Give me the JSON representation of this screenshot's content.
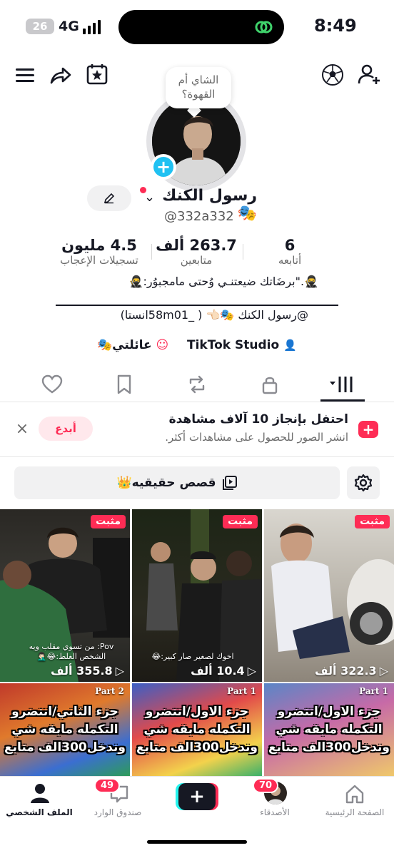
{
  "status_bar": {
    "battery": "26",
    "network": "4G",
    "time": "8:49"
  },
  "header": {
    "icons": [
      "menu-icon",
      "share-icon",
      "calendar-star-icon",
      "soccer-ball-icon",
      "add-friend-icon"
    ]
  },
  "profile": {
    "note_bubble": "الشاي أم القهوة؟",
    "name": "رسول الكنك",
    "name_emoji": "🎭",
    "handle": "@332a332",
    "stats": {
      "following": {
        "value": "6",
        "label": "أتابعه"
      },
      "followers": {
        "value": "263.7 ألف",
        "label": "متابعين"
      },
      "likes": {
        "value": "4.5 مليون",
        "label": "تسجيلات الإعجاب"
      }
    },
    "bio_line1": "🥷:برضَاتك ضيعتنـي وُحتى مامجبوُر\".🥷",
    "bio_line2": "@رسول الكنك 🎭👈🏻 ( _58m01انستا)",
    "tiktok_studio": "TikTok Studio",
    "family_link": "عائلتي🎭"
  },
  "tabs": [
    "videos-grid",
    "private",
    "repost",
    "saved",
    "liked"
  ],
  "promo": {
    "title": "احتفل بإنجاز 10 آلاف مشاهدة",
    "subtitle": "انشر الصور للحصول على مشاهدات أكثر.",
    "button": "أبدع"
  },
  "stories_button": "قصص حقيقيه👑",
  "videos": [
    {
      "pinned": "مثبت",
      "views": "322.3 ألف",
      "caption": ""
    },
    {
      "pinned": "مثبت",
      "views": "10.4 ألف",
      "caption": "اخوك لصغير صار كبير:😂"
    },
    {
      "pinned": "مثبت",
      "views": "355.8 ألف",
      "caption": "Pov: من تسوي مقلب ويه الشخص الغلط:😂🤦🏻‍♂️"
    }
  ],
  "videos_row2": [
    {
      "part": "Part 1",
      "text": "جزء الاول/انتضرو التكمله مابقه شي وندخل300الف متابع"
    },
    {
      "part": "Part 1",
      "text": "جزء الاول/انتضرو التكمله مابقه شي وندخل300الف متابع"
    },
    {
      "part": "Part 2",
      "text": "جزء الثاني/انتضرو التكمله مابقه شي وندخل300الف متابع"
    }
  ],
  "bottom_nav": {
    "home": "الصفحة الرئيسية",
    "friends": "الأصدقاء",
    "friends_badge": "70",
    "inbox": "صندوق الوارد",
    "inbox_badge": "49",
    "profile": "الملف الشخصي"
  }
}
